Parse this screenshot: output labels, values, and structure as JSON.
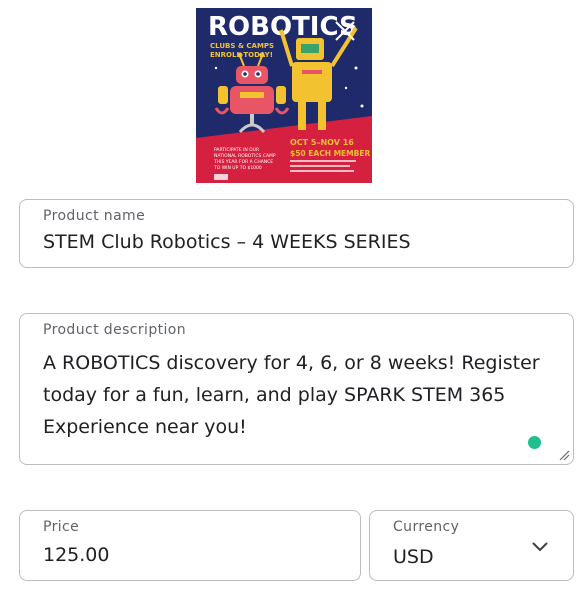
{
  "poster": {
    "title": "ROBOTICS",
    "subtitle_line1": "CLUBS & CAMPS",
    "subtitle_line2": "ENROLL TODAY!",
    "dates": "OCT 5–NOV 16",
    "price_tag": "$50 EACH MEMBER",
    "promo_line1": "PARTICIPATE IN OUR",
    "promo_line2": "NATIONAL ROBOTICS CAMP",
    "promo_line3": "THIS YEAR FOR A CHANCE",
    "promo_line4": "TO WIN UP TO $1000",
    "colors": {
      "background": "#1f2a6b",
      "band": "#d6203f",
      "robot_red": "#e85565",
      "robot_yellow": "#f2c230"
    }
  },
  "form": {
    "name": {
      "label": "Product name",
      "value": "STEM Club Robotics – 4 WEEKS SERIES"
    },
    "description": {
      "label": "Product description",
      "value": "A ROBOTICS discovery for 4, 6, or 8 weeks! Register today for a fun, learn, and play SPARK STEM 365 Experience near you!"
    },
    "price": {
      "label": "Price",
      "value": "125.00"
    },
    "currency": {
      "label": "Currency",
      "value": "USD"
    }
  },
  "icons": {
    "dropdown": "chevron-down-icon",
    "status_dot": "grammar-check-dot",
    "grip": "resize-grip-icon"
  }
}
